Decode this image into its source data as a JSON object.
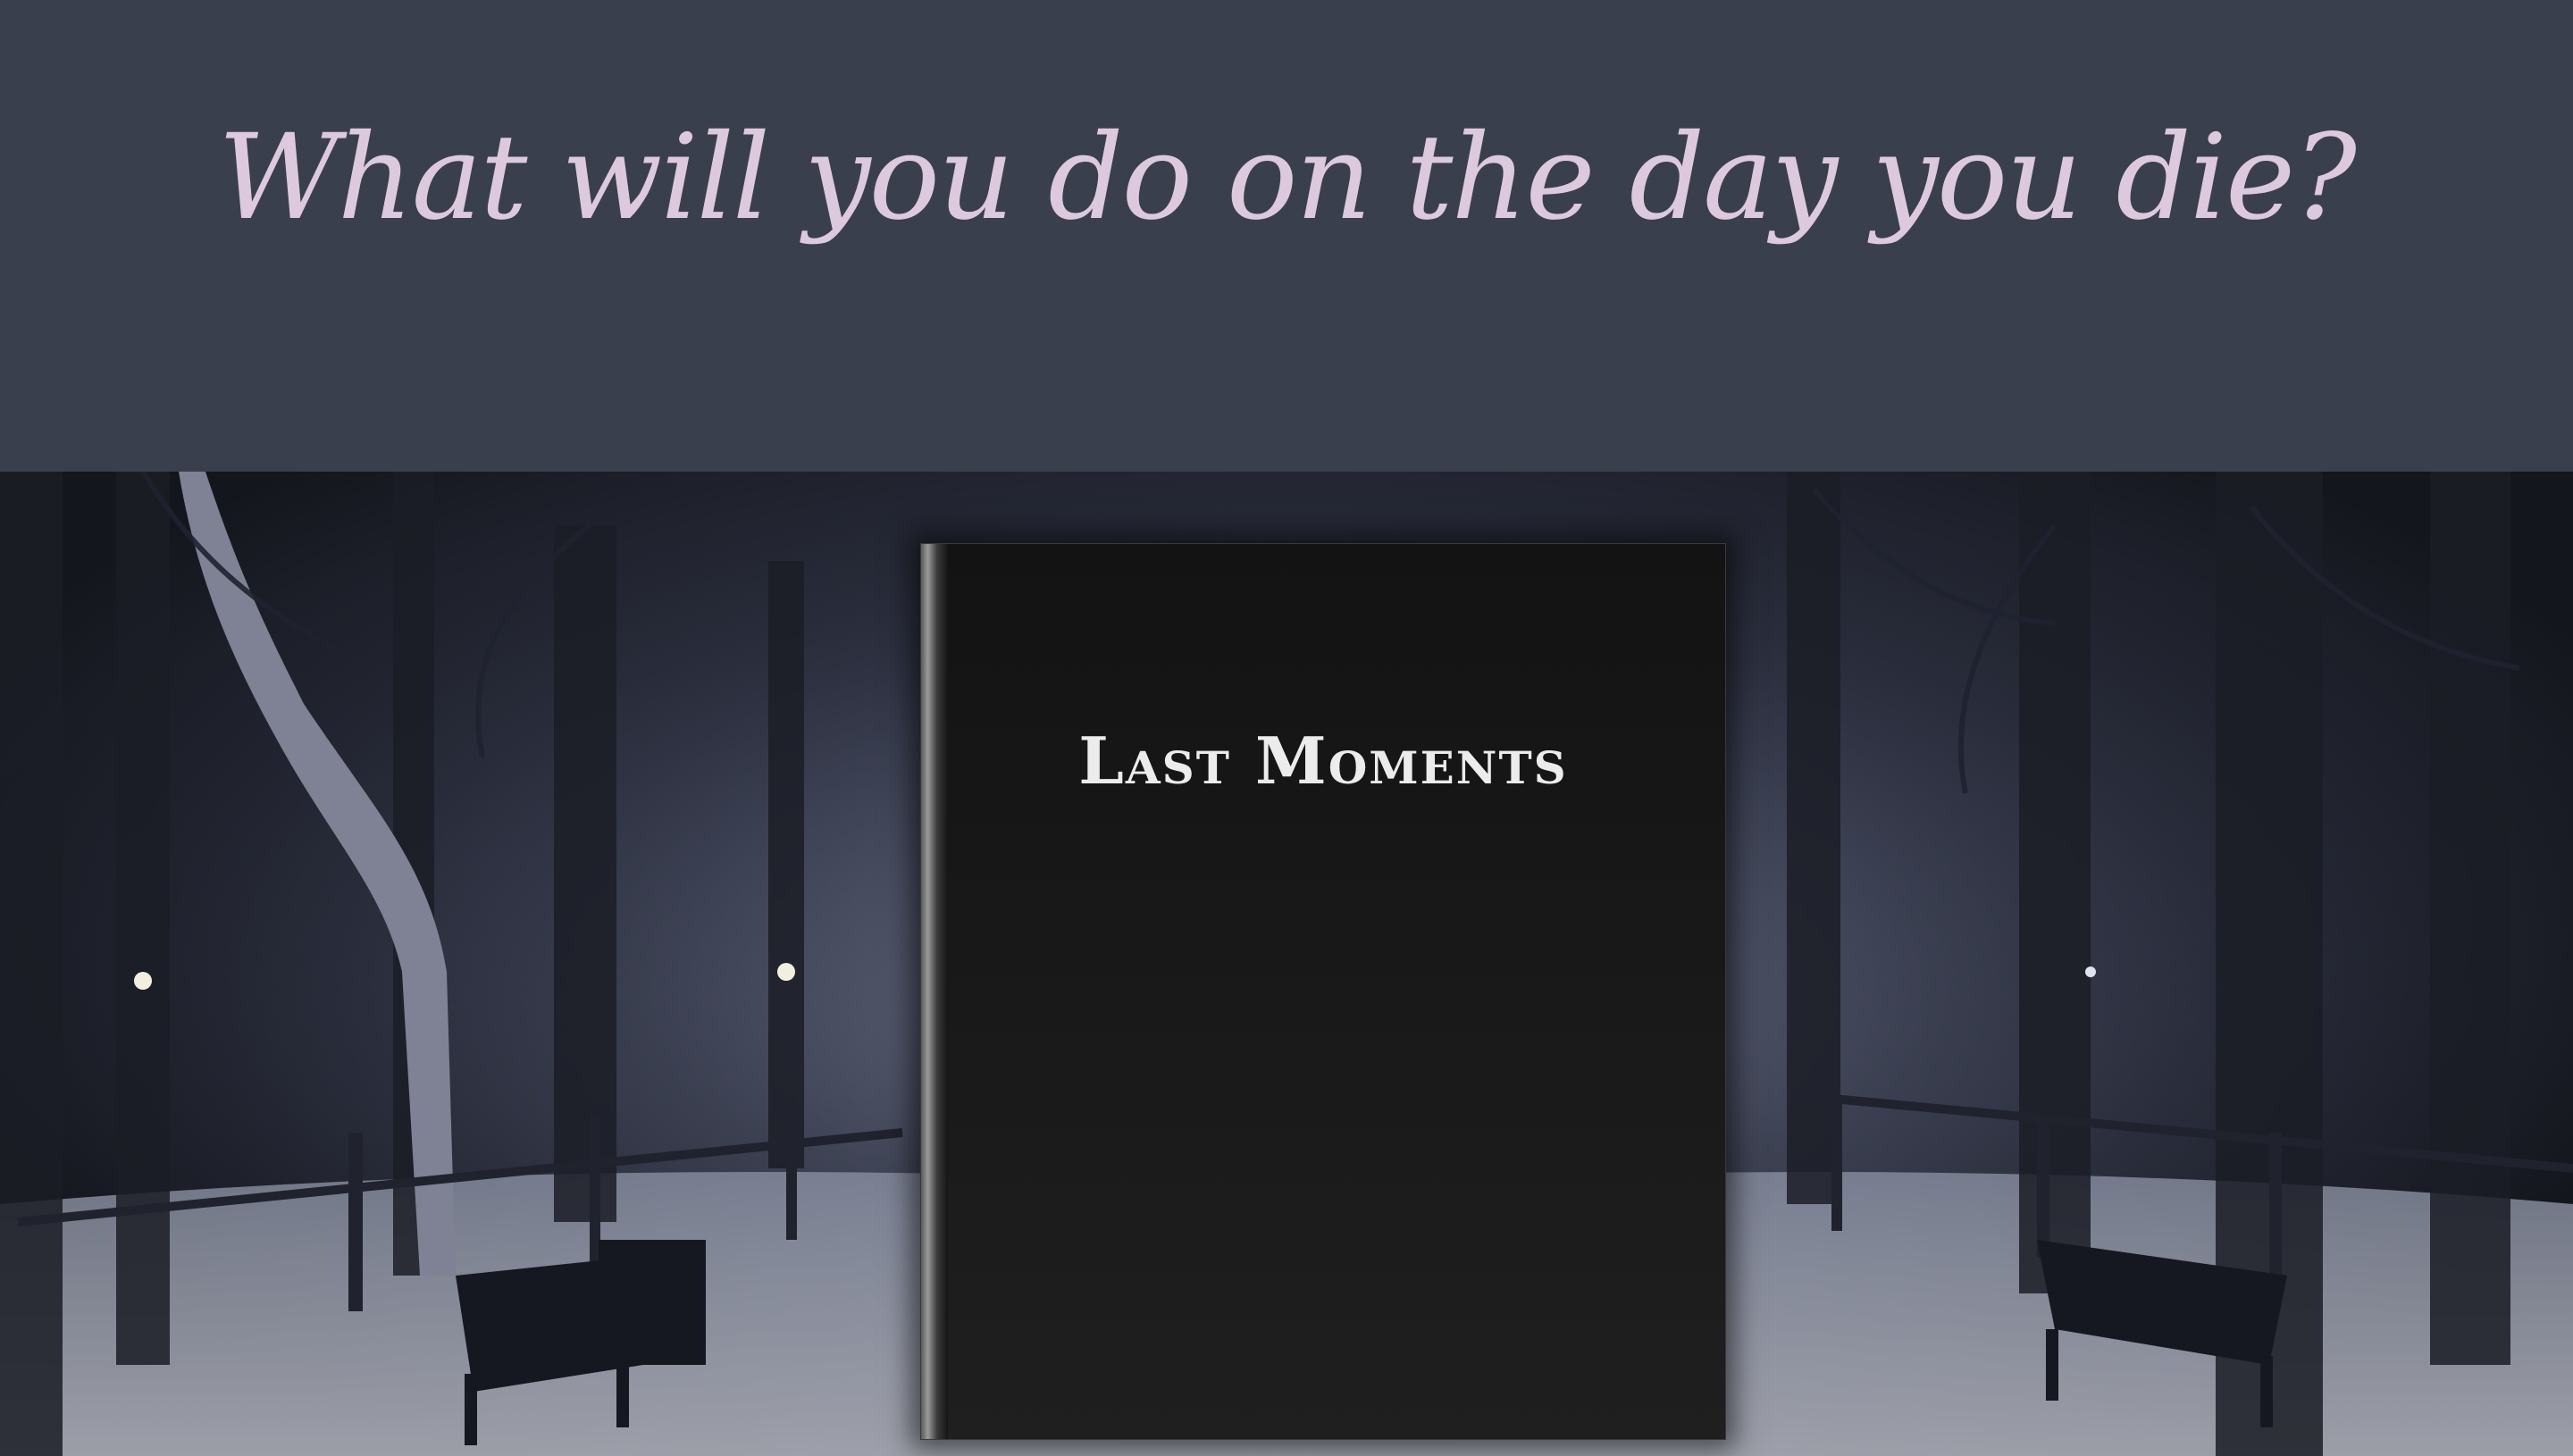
{
  "header": {
    "headline": "What will you do on the day you die?"
  },
  "book": {
    "title": "Last Moments"
  },
  "colors": {
    "header_bg": "#3a3f4e",
    "headline_text": "#ddc9dd",
    "book_cover": "#181818",
    "book_title_text": "#ececec"
  }
}
